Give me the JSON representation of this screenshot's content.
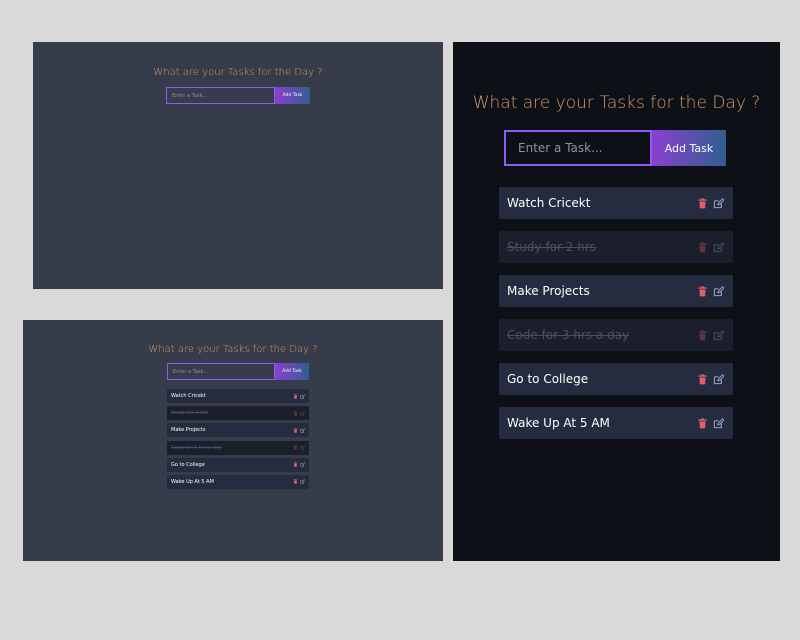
{
  "app": {
    "heading": "What are your Tasks for the Day ?",
    "input_placeholder": "Enter a Task...",
    "add_button_label": "Add Task"
  },
  "tasks": [
    {
      "text": "Watch Cricekt",
      "completed": false
    },
    {
      "text": "Study for 2 hrs",
      "completed": true
    },
    {
      "text": "Make Projects",
      "completed": false
    },
    {
      "text": "Code for 3 hrs a day",
      "completed": true
    },
    {
      "text": "Go to College",
      "completed": false
    },
    {
      "text": "Wake Up At 5 AM",
      "completed": false
    }
  ],
  "icons": {
    "delete": "trash-icon",
    "edit": "edit-icon"
  },
  "colors": {
    "heading": "#d49a6a",
    "delete_icon": "#e2606b",
    "edit_icon": "#9aa3b2",
    "input_border": "#8b5cf6",
    "button_gradient_start": "#8b3fd1",
    "button_gradient_end": "#2f5f8e",
    "task_bg": "#262c3f",
    "task_done_bg": "#1b1f2c"
  }
}
